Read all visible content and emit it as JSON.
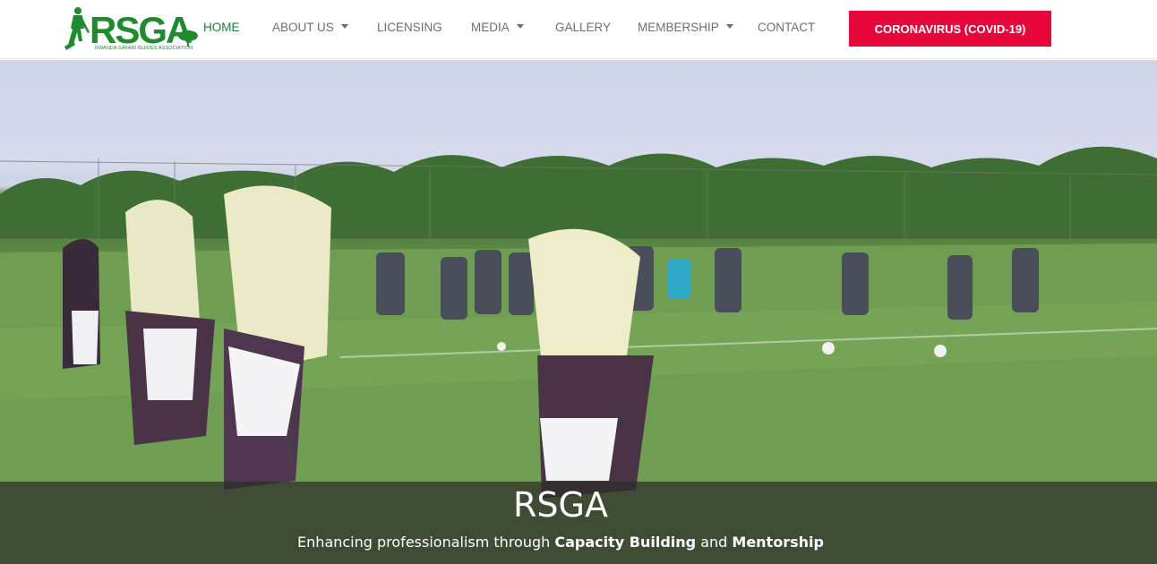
{
  "brand": {
    "logo_text": "RSGA",
    "logo_subtitle": "RWANDA SAFARI GUIDES ASSOCIATION"
  },
  "nav": {
    "home": "HOME",
    "about": "ABOUT US",
    "licensing": "LICENSING",
    "media": "MEDIA",
    "gallery": "GALLERY",
    "membership": "MEMBERSHIP",
    "contact": "CONTACT",
    "covid_button": "CORONAVIRUS (COVID-19)"
  },
  "hero": {
    "title": "RSGA",
    "tagline_pre": "Enhancing professionalism through ",
    "tagline_bold1": "Capacity Building",
    "tagline_mid": " and ",
    "tagline_bold2": "Mentorship"
  },
  "colors": {
    "brand_green": "#1f8a2e",
    "active_nav": "#1f7a3a",
    "covid_red": "#e8073b"
  }
}
